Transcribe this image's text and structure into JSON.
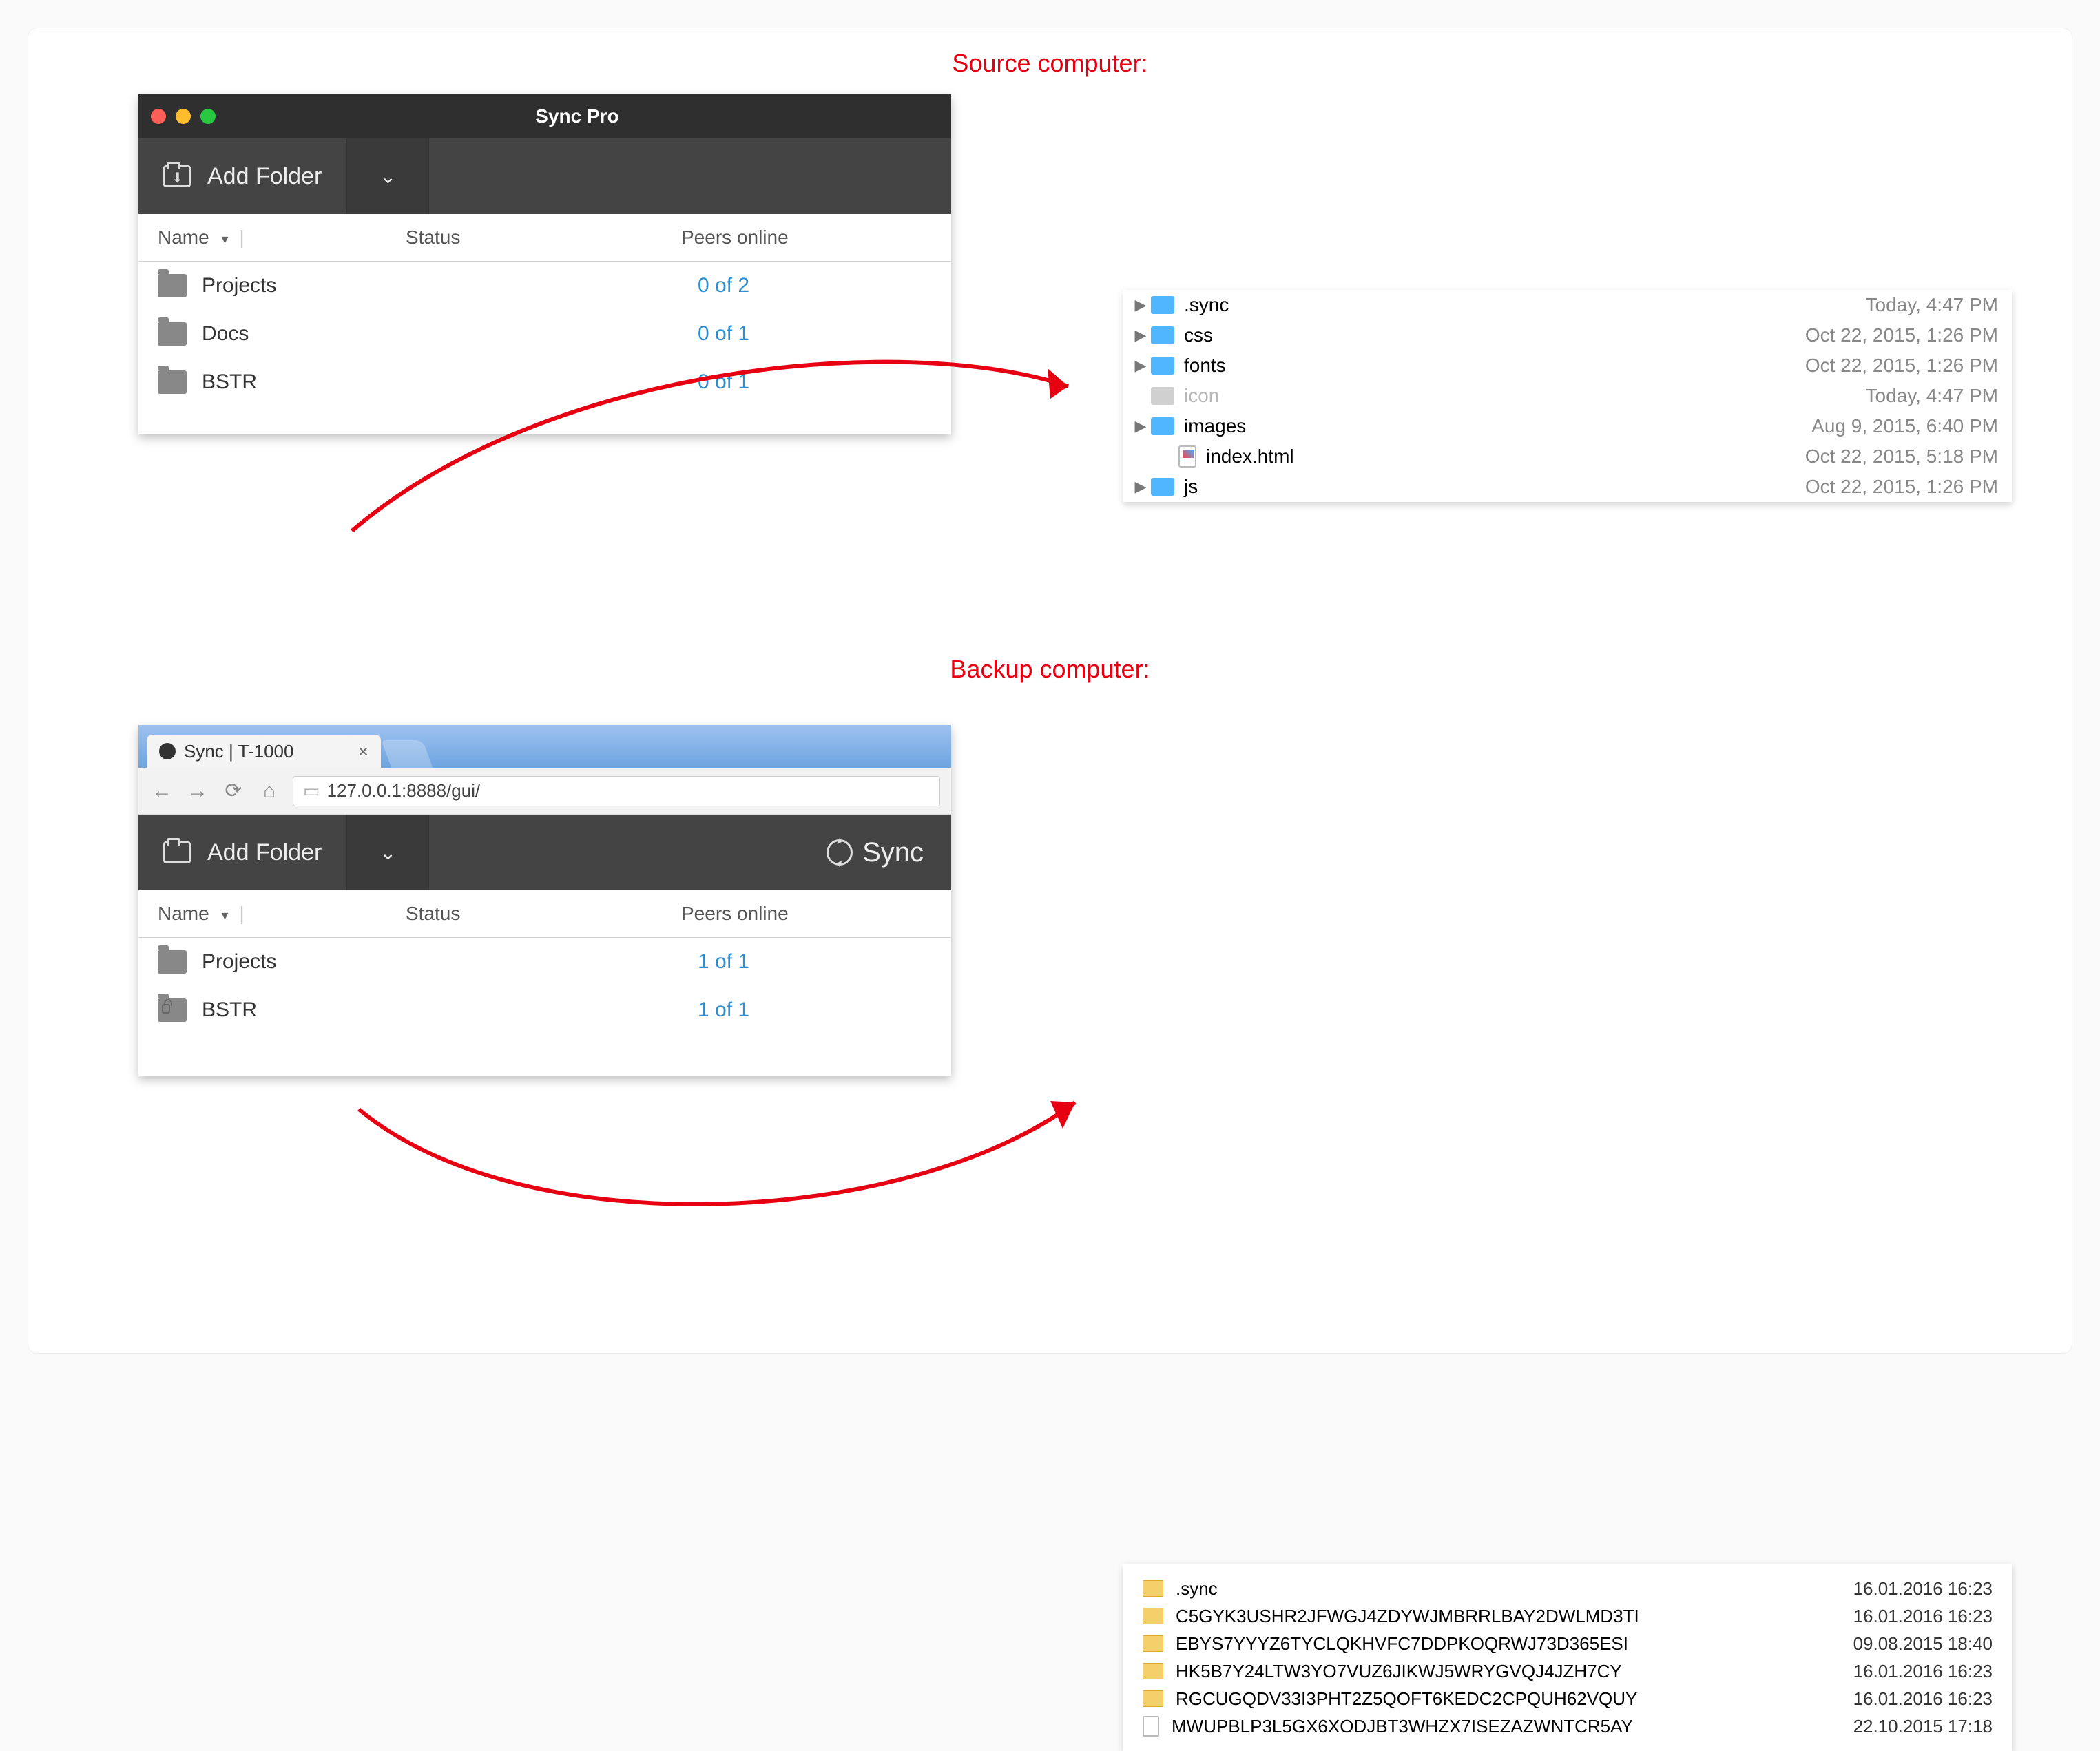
{
  "labels": {
    "source": "Source computer:",
    "backup": "Backup computer:"
  },
  "source_app": {
    "window_title": "Sync Pro",
    "add_folder_label": "Add Folder",
    "columns": {
      "name": "Name",
      "status": "Status",
      "peers": "Peers online"
    },
    "rows": [
      {
        "name": "Projects",
        "peers": "0 of 2"
      },
      {
        "name": "Docs",
        "peers": "0 of 1"
      },
      {
        "name": "BSTR",
        "peers": "0 of 1"
      }
    ]
  },
  "source_finder": {
    "items": [
      {
        "type": "folder",
        "name": ".sync",
        "date": "Today, 4:47 PM",
        "expandable": true
      },
      {
        "type": "folder",
        "name": "css",
        "date": "Oct 22, 2015, 1:26 PM",
        "expandable": true
      },
      {
        "type": "folder",
        "name": "fonts",
        "date": "Oct 22, 2015, 1:26 PM",
        "expandable": true
      },
      {
        "type": "dimfile",
        "name": "icon",
        "date": "Today, 4:47 PM",
        "expandable": false
      },
      {
        "type": "folder",
        "name": "images",
        "date": "Aug 9, 2015, 6:40 PM",
        "expandable": true
      },
      {
        "type": "file",
        "name": "index.html",
        "date": "Oct 22, 2015, 5:18 PM",
        "expandable": false,
        "indent": true
      },
      {
        "type": "folder",
        "name": "js",
        "date": "Oct 22, 2015, 1:26 PM",
        "expandable": true
      }
    ]
  },
  "backup_browser": {
    "tab_title": "Sync | T-1000",
    "url": "127.0.0.1:8888/gui/"
  },
  "backup_app": {
    "add_folder_label": "Add Folder",
    "sync_label": "Sync",
    "columns": {
      "name": "Name",
      "status": "Status",
      "peers": "Peers online"
    },
    "rows": [
      {
        "name": "Projects",
        "peers": "1 of 1",
        "locked": false
      },
      {
        "name": "BSTR",
        "peers": "1 of 1",
        "locked": true
      }
    ]
  },
  "backup_explorer": {
    "items": [
      {
        "type": "fold",
        "name": ".sync",
        "date": "16.01.2016 16:23"
      },
      {
        "type": "fold",
        "name": "C5GYK3USHR2JFWGJ4ZDYWJMBRRLBAY2DWLMD3TI",
        "date": "16.01.2016 16:23"
      },
      {
        "type": "fold",
        "name": "EBYS7YYYZ6TYCLQKHVFC7DDPKOQRWJ73D365ESI",
        "date": "09.08.2015 18:40"
      },
      {
        "type": "fold",
        "name": "HK5B7Y24LTW3YO7VUZ6JIKWJ5WRYGVQJ4JZH7CY",
        "date": "16.01.2016 16:23"
      },
      {
        "type": "fold",
        "name": "RGCUGQDV33I3PHT2Z5QOFT6KEDC2CPQUH62VQUY",
        "date": "16.01.2016 16:23"
      },
      {
        "type": "file",
        "name": "MWUPBLP3L5GX6XODJBT3WHZX7ISEZAZWNTCR5AY",
        "date": "22.10.2015 17:18"
      }
    ]
  }
}
